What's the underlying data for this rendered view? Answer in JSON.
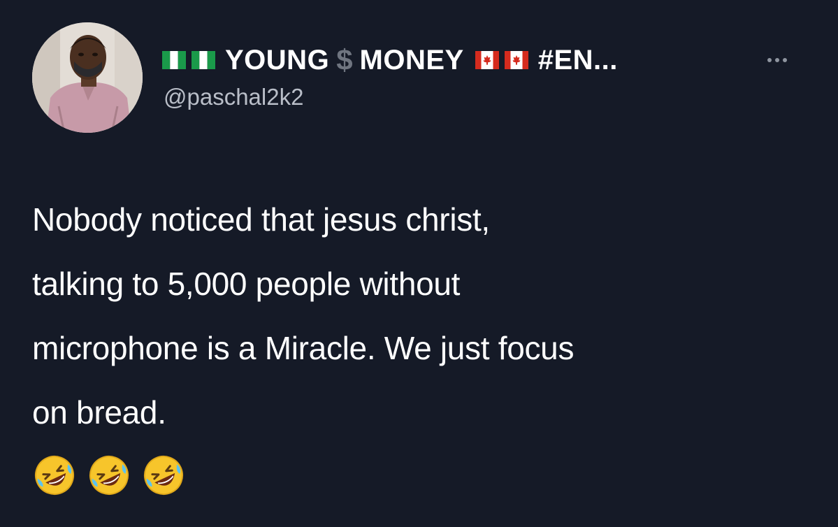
{
  "tweet": {
    "display_name": {
      "before": "YOUNG",
      "dollar": "$",
      "after": "MONEY",
      "hashtag": "#EN..."
    },
    "handle": "@paschal2k2",
    "body_lines": [
      "Nobody noticed that jesus christ,",
      "talking to 5,000 people without",
      "microphone is a Miracle. We just focus",
      "on bread."
    ],
    "flags_before": [
      "nigeria-flag-icon",
      "nigeria-flag-icon"
    ],
    "flags_after": [
      "canada-flag-icon",
      "canada-flag-icon"
    ],
    "emojis": [
      "rolling-on-floor-laughing-icon",
      "rolling-on-floor-laughing-icon",
      "rolling-on-floor-laughing-icon"
    ],
    "more_menu_icon": "more-options-icon"
  },
  "colors": {
    "background": "#151a27",
    "primary_text": "#ffffff",
    "secondary_text": "#b9bec8",
    "dollar_sign": "#6f7580",
    "nigeria_green": "#1a9a4a",
    "canada_red": "#d52b1e"
  }
}
